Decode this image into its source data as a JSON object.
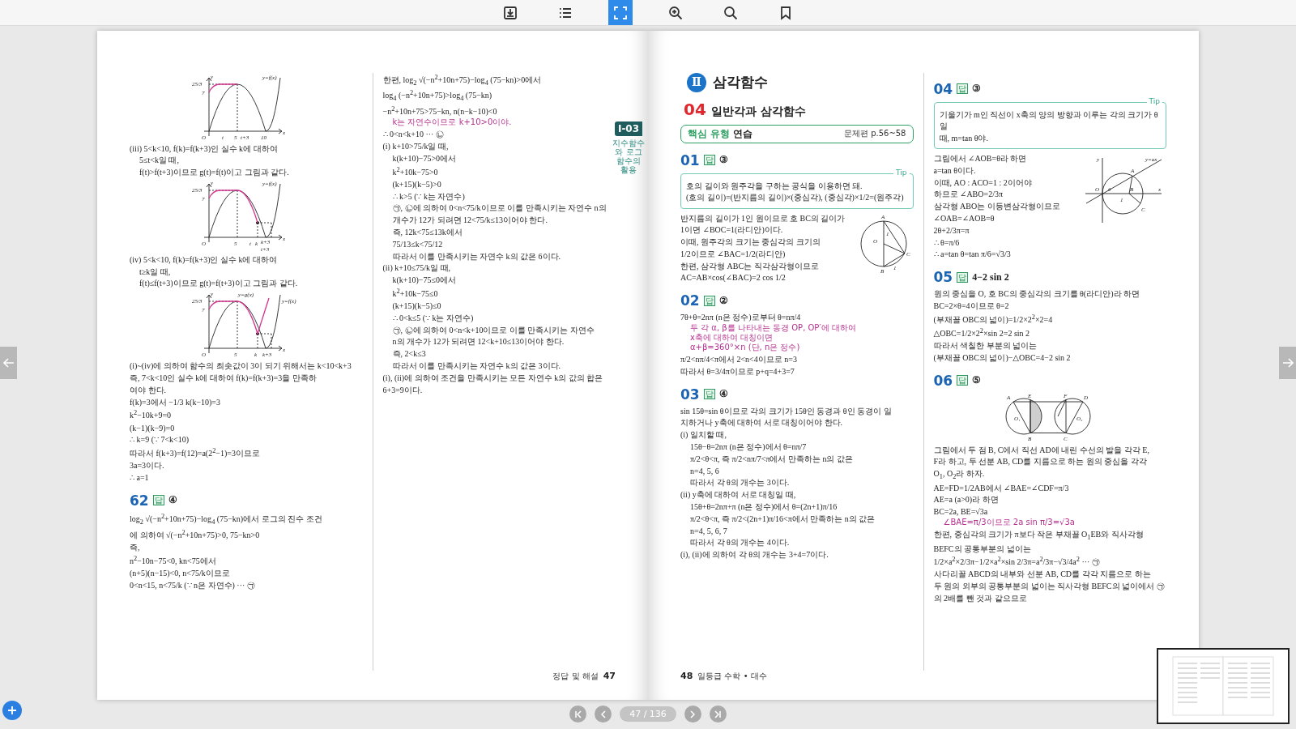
{
  "toolbar": [
    {
      "kind": "download",
      "selected": false
    },
    {
      "kind": "list",
      "selected": false
    },
    {
      "kind": "fullscreen",
      "selected": true
    },
    {
      "kind": "zoom-in",
      "selected": false
    },
    {
      "kind": "search",
      "selected": false
    },
    {
      "kind": "bookmark",
      "selected": false
    }
  ],
  "pages": [
    {
      "kind": "left",
      "side_tab": {
        "label": "Ⅰ-03",
        "caption": "지수함수와 로그함수의 활용"
      },
      "columns": [
        [
          {
            "kind": "g-a",
            "labels": [
              "y",
              "25/3",
              "7",
              "y=f(x)",
              "O",
              "t",
              "5",
              "t+3",
              "10",
              "x"
            ]
          },
          {
            "kind": "text",
            "text": "(iii) 5<k<10, f(k)=f(k+3)인 실수 k에 대하여"
          },
          {
            "kind": "indent",
            "text": "5≤t<k일 때,"
          },
          {
            "kind": "indent",
            "text": "f(t)>f(t+3)이므로 g(t)=f(t)이고 그림과 같다."
          },
          {
            "kind": "g-b",
            "labels": [
              "y",
              "25/3",
              "7",
              "y=f(x)",
              "O",
              "5",
              "t",
              "k",
              "k+3",
              "t+3",
              "x"
            ]
          },
          {
            "kind": "text",
            "text": "(iv) 5<k<10, f(k)=f(k+3)인 실수 k에 대하여"
          },
          {
            "kind": "indent",
            "text": "t≥k일 때,"
          },
          {
            "kind": "indent",
            "text": "f(t)≤f(t+3)이므로 g(t)=f(t+3)이고 그림과 같다."
          },
          {
            "kind": "g-c",
            "labels": [
              "y",
              "25/3",
              "7",
              "y=g(x)",
              "y=f(x)",
              "O",
              "5",
              "k",
              "k+3",
              "x"
            ]
          },
          {
            "kind": "text",
            "text": "(i)~(iv)에 의하여 함수의 최솟값이 3이 되기 위해서는 k<10<k+3"
          },
          {
            "kind": "text",
            "text": "즉, 7<k<10인 실수 k에 대하여 f(k)=f(k+3)=3을 만족하"
          },
          {
            "kind": "text",
            "text": "여야 한다."
          },
          {
            "kind": "text",
            "text": "f(k)=3에서 −1/3 k(k−10)=3"
          },
          {
            "kind": "text",
            "text": "k$^{2}$−10k+9=0"
          },
          {
            "kind": "text",
            "text": "(k−1)(k−9)=0"
          },
          {
            "kind": "text",
            "text": "∴ k=9 (∵ 7<k<10)"
          },
          {
            "kind": "text",
            "text": "따라서 f(k+3)=f(12)=a(2$^{2}$−1)=3이므로"
          },
          {
            "kind": "text",
            "text": "3a=3이다."
          },
          {
            "kind": "text",
            "text": "∴ a=1"
          },
          {
            "kind": "heading",
            "number": "62",
            "mark": "답",
            "answer": "④"
          },
          {
            "kind": "text",
            "text": "log$_{2}$ √(−n$^{2}$+10n+75)−log$_{4}$ (75−kn)에서 로그의 진수 조건"
          },
          {
            "kind": "text",
            "text": "에 의하여 √(−n$^{2}$+10n+75)>0, 75−kn>0"
          },
          {
            "kind": "text",
            "text": "즉,"
          },
          {
            "kind": "text",
            "text": "n$^{2}$−10n−75<0, kn<75에서"
          },
          {
            "kind": "text",
            "text": "(n+5)(n−15)<0, n<75/k이므로"
          },
          {
            "kind": "text",
            "text": "0<n<15, n<75/k (∵ n은 자연수) ··· ㉠"
          }
        ],
        [
          {
            "kind": "text",
            "text": "한편, log$_{2}$ √(−n$^{2}$+10n+75)−log$_{4}$ (75−kn)>0에서"
          },
          {
            "kind": "text",
            "text": "log$_{4}$ (−n$^{2}$+10n+75)>log$_{4}$ (75−kn)"
          },
          {
            "kind": "text",
            "text": "−n$^{2}$+10n+75>75−kn, n(n−k−10)<0"
          },
          {
            "kind": "note",
            "lines": [
              "k는 자연수이므로 k+10>0이야."
            ]
          },
          {
            "kind": "text",
            "text": "∴ 0<n<k+10 ··· ㉡"
          },
          {
            "kind": "text",
            "text": "(i) k+10>75/k일 때,"
          },
          {
            "kind": "indent",
            "text": "k(k+10)−75>0에서"
          },
          {
            "kind": "indent",
            "text": "k$^{2}$+10k−75>0"
          },
          {
            "kind": "indent",
            "text": "(k+15)(k−5)>0"
          },
          {
            "kind": "indent",
            "text": "∴ k>5 (∵ k는 자연수)"
          },
          {
            "kind": "indent",
            "text": "㉠, ㉡에 의하여 0<n<75/k이므로 이를 만족시키는 자연수 n의"
          },
          {
            "kind": "indent",
            "text": "개수가 12가 되려면 12<75/k≤13이어야 한다."
          },
          {
            "kind": "indent",
            "text": "즉, 12k<75≤13k에서"
          },
          {
            "kind": "indent",
            "text": "75/13≤k<75/12"
          },
          {
            "kind": "indent",
            "text": "따라서 이를 만족시키는 자연수 k의 값은 6이다."
          },
          {
            "kind": "text",
            "text": "(ii) k+10≤75/k일 때,"
          },
          {
            "kind": "indent",
            "text": "k(k+10)−75≤0에서"
          },
          {
            "kind": "indent",
            "text": "k$^{2}$+10k−75≤0"
          },
          {
            "kind": "indent",
            "text": "(k+15)(k−5)≤0"
          },
          {
            "kind": "indent",
            "text": "∴ 0<k≤5 (∵ k는 자연수)"
          },
          {
            "kind": "indent",
            "text": "㉠, ㉡에 의하여 0<n<k+10이므로 이를 만족시키는 자연수"
          },
          {
            "kind": "indent",
            "text": "n의 개수가 12가 되려면 12<k+10≤13이어야 한다."
          },
          {
            "kind": "indent",
            "text": "즉, 2<k≤3"
          },
          {
            "kind": "indent",
            "text": "따라서 이를 만족시키는 자연수 k의 값은 3이다."
          },
          {
            "kind": "text",
            "text": "(i), (ii)에 의하여 조건을 만족시키는 모든 자연수 k의 값의 합은"
          },
          {
            "kind": "text",
            "text": "6+3=9이다."
          }
        ]
      ],
      "footer": {
        "label": "정답 및 해설",
        "number": "47"
      }
    },
    {
      "kind": "right",
      "columns": [
        [
          {
            "kind": "chapter",
            "numeral": "Ⅱ",
            "title": "삼각함수"
          },
          {
            "kind": "section",
            "number": "04",
            "title": "일반각과 삼각함수"
          },
          {
            "kind": "banner",
            "emphasis": "핵심 유형",
            "title": "연습",
            "ref": "문제편 p.56~58"
          },
          {
            "kind": "heading",
            "number": "01",
            "mark": "답",
            "answer": "③"
          },
          {
            "kind": "tip",
            "label": "Tip",
            "lines": [
              "호의 길이와 원주각을 구하는 공식을 이용하면 돼.",
              "(호의 길이)=(반지름의 길이)×(중심각), (중심각)×1/2=(원주각)"
            ]
          },
          {
            "kind": "figure-row",
            "figure": {
              "kind": "circle-triangle",
              "labels": [
                "A",
                "O",
                "B",
                "C",
                "1",
                "1"
              ]
            },
            "lines": [
              "반지름의 길이가 1인 원이므로 호 BC의 길이가",
              "1이면 ∠BOC=1(라디안)이다.",
              "이때, 원주각의 크기는 중심각의 크기의",
              "1/2이므로 ∠BAC=1/2(라디안)",
              "한편, 삼각형 ABC는 직각삼각형이므로",
              "AC=AB×cos(∠BAC)=2 cos 1/2"
            ]
          },
          {
            "kind": "heading",
            "number": "02",
            "mark": "답",
            "answer": "②"
          },
          {
            "kind": "text",
            "text": "7θ+θ=2nπ (n은 정수)로부터 θ=nπ/4"
          },
          {
            "kind": "note",
            "lines": [
              "두 각 α, β를 나타내는 동경 OP, OP′에 대하여",
              "x축에 대하여 대칭이면",
              "α+β=360°×n (단, n은 정수)"
            ]
          },
          {
            "kind": "text",
            "text": "π/2<nπ/4<π에서 2<n<4이므로 n=3"
          },
          {
            "kind": "text",
            "text": "따라서 θ=3/4π이므로 p+q=4+3=7"
          },
          {
            "kind": "heading",
            "number": "03",
            "mark": "답",
            "answer": "④"
          },
          {
            "kind": "text",
            "text": "sin 15θ=sin θ이므로 각의 크기가 15θ인 동경과 θ인 동경이 일"
          },
          {
            "kind": "text",
            "text": "치하거나 y축에 대하여 서로 대칭이어야 한다."
          },
          {
            "kind": "text",
            "text": "(i) 일치할 때,"
          },
          {
            "kind": "indent",
            "text": "15θ−θ=2nπ (n은 정수)에서 θ=nπ/7"
          },
          {
            "kind": "indent",
            "text": "π/2<θ<π, 즉 π/2<nπ/7<π에서 만족하는 n의 값은"
          },
          {
            "kind": "indent",
            "text": "n=4, 5, 6"
          },
          {
            "kind": "indent",
            "text": "따라서 각 θ의 개수는 3이다."
          },
          {
            "kind": "text",
            "text": "(ii) y축에 대하여 서로 대칭일 때,"
          },
          {
            "kind": "indent",
            "text": "15θ+θ=2nπ+π (n은 정수)에서 θ=(2n+1)π/16"
          },
          {
            "kind": "indent",
            "text": "π/2<θ<π, 즉 π/2<(2n+1)π/16<π에서 만족하는 n의 값은"
          },
          {
            "kind": "indent",
            "text": "n=4, 5, 6, 7"
          },
          {
            "kind": "indent",
            "text": "따라서 각 θ의 개수는 4이다."
          },
          {
            "kind": "text",
            "text": "(i), (ii)에 의하여 각 θ의 개수는 3+4=7이다."
          }
        ],
        [
          {
            "kind": "heading",
            "number": "04",
            "mark": "답",
            "answer": "③"
          },
          {
            "kind": "tip",
            "label": "Tip",
            "lines": [
              "기울기가 m인 직선이 x축의 양의 방향과 이루는 각의 크기가 θ일",
              "때, m=tan θ야."
            ]
          },
          {
            "kind": "figure-row",
            "figure": {
              "kind": "circle-axes",
              "labels": [
                "y",
                "y=ax",
                "A",
                "O",
                "θ",
                "B",
                "1",
                "x",
                "C"
              ]
            },
            "lines": [
              "그림에서 ∠AOB=θ라 하면",
              "a=tan θ이다.",
              "이때, AO : ACO=1 : 2이어야",
              "하므로 ∠ABO=2/3π",
              "삼각형 ABO는 이등변삼각형이므로",
              "∠OAB=∠AOB=θ",
              "2θ+2/3π=π",
              "∴ θ=π/6",
              "∴ a=tan θ=tan π/6=√3/3"
            ]
          },
          {
            "kind": "heading",
            "number": "05",
            "mark": "답",
            "answer": "4−2 sin 2"
          },
          {
            "kind": "text",
            "text": "원의 중심을 O, 호 BC의 중심각의 크기를 θ(라디안)라 하면"
          },
          {
            "kind": "text",
            "text": "BC=2×θ=4이므로 θ=2"
          },
          {
            "kind": "text",
            "text": "(부채꼴 OBC의 넓이)=1/2×2$^{2}$×2=4"
          },
          {
            "kind": "text",
            "text": "△OBC=1/2×2$^{2}$×sin 2=2 sin 2"
          },
          {
            "kind": "text",
            "text": "따라서 색칠한 부분의 넓이는"
          },
          {
            "kind": "text",
            "text": "(부채꼴 OBC의 넓이)−△OBC=4−2 sin 2"
          },
          {
            "kind": "heading",
            "number": "06",
            "mark": "답",
            "answer": "⑤"
          },
          {
            "kind": "two-circles",
            "labels": [
              "A",
              "E",
              "F",
              "D",
              "O₁",
              "O₂",
              "B",
              "C"
            ]
          },
          {
            "kind": "text",
            "text": "그림에서 두 점 B, C에서 직선 AD에 내린 수선의 발을 각각 E,"
          },
          {
            "kind": "text",
            "text": "F라 하고, 두 선분 AB, CD를 지름으로 하는 원의 중심을 각각"
          },
          {
            "kind": "text",
            "text": "O$_{1}$, O$_{2}$라 하자."
          },
          {
            "kind": "text",
            "text": "AE=FD=1/2AB에서 ∠BAE=∠CDF=π/3"
          },
          {
            "kind": "text",
            "text": "AE=a (a>0)라 하면"
          },
          {
            "kind": "text",
            "text": "BC=2a, BE=√3a"
          },
          {
            "kind": "note",
            "lines": [
              "∠BAE=π/3이므로 2a sin π/3=√3a"
            ]
          },
          {
            "kind": "text",
            "text": "한편, 중심각의 크기가 π보다 작은 부채꼴 O$_{1}$EB와 직사각형"
          },
          {
            "kind": "text",
            "text": "BEFC의 공통부분의 넓이는"
          },
          {
            "kind": "text",
            "text": "1/2×a$^{2}$×2/3π−1/2×a$^{2}$×sin 2/3π=a$^{2}$/3π−√3/4a$^{2}$ ··· ㉠"
          },
          {
            "kind": "text",
            "text": "사다리꼴 ABCD의 내부와 선분 AB, CD를 각각 지름으로 하는"
          },
          {
            "kind": "text",
            "text": "두 원의 외부의 공통부분의 넓이는 직사각형 BEFC의 넓이에서 ㉠"
          },
          {
            "kind": "text",
            "text": "의 2배를 뺀 것과 같으므로"
          }
        ]
      ],
      "footer": {
        "label": "일등급 수학 • 대수",
        "number": "48"
      }
    }
  ],
  "pager": {
    "indicator": "47 / 136"
  }
}
